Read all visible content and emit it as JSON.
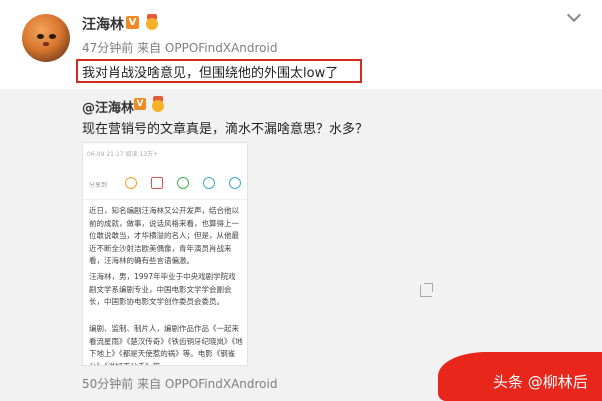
{
  "post": {
    "username": "汪海林",
    "verified_badge": "V",
    "meta": "47分钟前 来自 OPPOFindXAndroid",
    "text": "我对肖战没啥意见，但围绕他的外围太low了",
    "icons": {
      "avatar": "cat-avatar",
      "menu": "chevron-down-icon",
      "medal": "medal-icon"
    }
  },
  "repost": {
    "username": "@汪海林",
    "verified_badge": "V",
    "text": "现在营销号的文章真是，滴水不漏啥意思？水多？",
    "meta": "50分钟前 来自 OPPOFindXAndroid",
    "screenshot": {
      "header": "06-09 21:17  阅读 13万+",
      "share_label": "分享到",
      "share_icons": [
        "weibo-icon",
        "mail-icon",
        "wechat-icon",
        "qzone-icon",
        "qq-icon"
      ],
      "paragraphs": [
        "近日，知名编剧汪海林又公开发声，结合他以前的成就，做事，说话风格来看，也算得上一位敢说敢当，才华横溢的名人；但是，从他最近不断全沙射洁欧美偶像，青年演员肖战来看，汪海林的确有些言语偏激。",
        "汪海林，男，1997年毕业于中央戏剧学院戏剧文学系编剧专业，中国电影文学学会副会长，中国影协电影文学创作委员会委员。",
        "编剧、监制、制片人，编剧作品作品《一起来看流星雨》《楚汉传奇》《铁齿铜牙纪晓岚》《地下地上》《都是天使惹的祸》等。电影《钢雀台》《说好不分手》等。"
      ]
    }
  },
  "watermark": {
    "text": "头条 @柳林后"
  },
  "colors": {
    "highlight_border": "#d62b1c",
    "badge": "#f08a24",
    "watermark_bg": "#e8261c",
    "repost_bg": "#f2f2f2"
  }
}
